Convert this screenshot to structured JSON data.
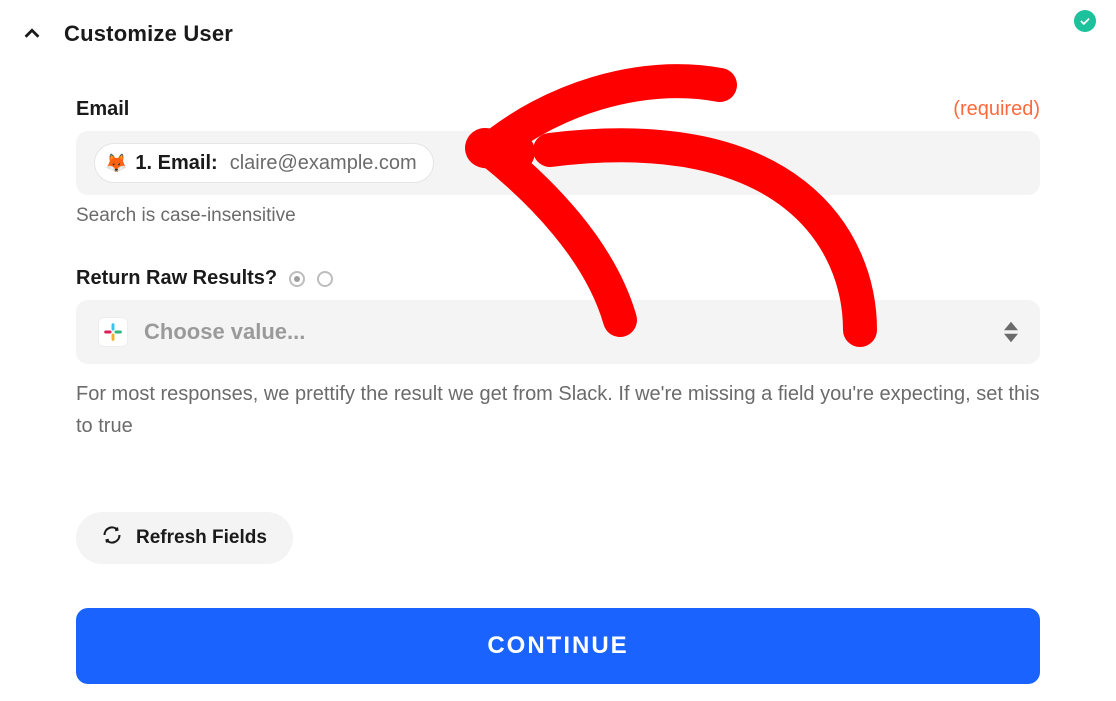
{
  "header": {
    "title": "Customize User",
    "status_icon": "check-circle"
  },
  "email_field": {
    "label": "Email",
    "required_text": "(required)",
    "token": {
      "emoji": "🦊",
      "label": "1. Email:",
      "value": "claire@example.com"
    },
    "helper": "Search is case-insensitive"
  },
  "raw_results_field": {
    "label": "Return Raw Results?",
    "radio_options": [
      "selected",
      "unselected"
    ],
    "select_placeholder": "Choose value...",
    "select_icon": "slack",
    "description": "For most responses, we prettify the result we get from Slack. If we're missing a field you're expecting, set this to true"
  },
  "buttons": {
    "refresh": "Refresh Fields",
    "continue": "CONTINUE"
  },
  "annotation": {
    "type": "hand-drawn-arrow",
    "color": "#ff0000"
  }
}
